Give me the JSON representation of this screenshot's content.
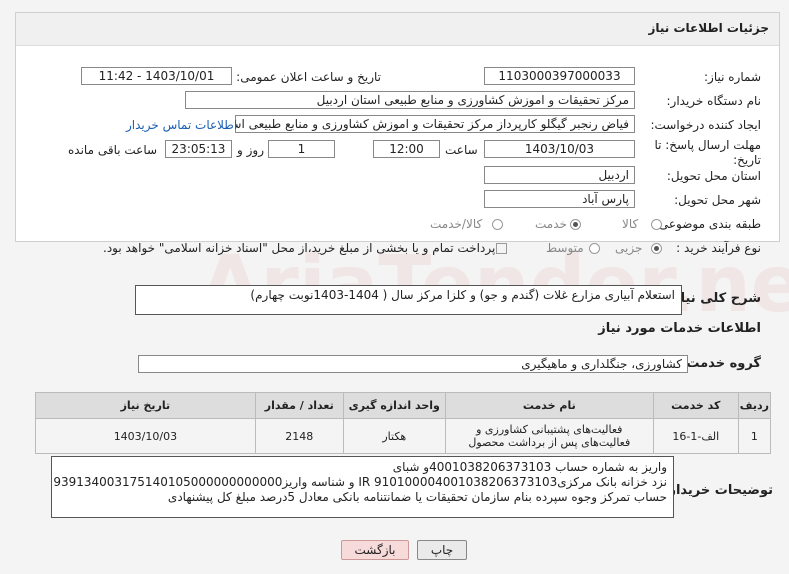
{
  "header": {
    "title": "جزئیات اطلاعات نیاز"
  },
  "form": {
    "need_number_label": "شماره نیاز:",
    "need_number": "1103000397000033",
    "announce_label": "تاریخ و ساعت اعلان عمومی:",
    "announce_value": "1403/10/01 - 11:42",
    "buyer_org_label": "نام دستگاه خریدار:",
    "buyer_org": "مرکز تحقیقات و اموزش کشاورزی و منابع طبیعی استان اردبیل",
    "creator_label": "ایجاد کننده درخواست:",
    "creator": "فیاض رنجبر گیگلو کارپرداز مرکز تحقیقات و اموزش کشاورزی و منابع طبیعی استان اردبیل",
    "contact_link": "اطلاعات تماس خریدار",
    "deadline_label": "مهلت ارسال پاسخ: تا تاریخ:",
    "deadline_date": "1403/10/03",
    "time_label": "ساعت",
    "deadline_time": "12:00",
    "days_value": "1",
    "days_label": "روز و",
    "remaining_time": "23:05:13",
    "remaining_label": "ساعت باقی مانده",
    "province_label": "استان محل تحویل:",
    "province": "اردبیل",
    "city_label": "شهر محل تحویل:",
    "city": "پارس آباد",
    "category_label": "طبقه بندی موضوعی:",
    "category_options": [
      "کالا",
      "خدمت",
      "کالا/خدمت"
    ],
    "process_label": "نوع فرآیند خرید :",
    "process_options": [
      "جزیی",
      "متوسط"
    ],
    "payment_note": "پرداخت تمام و یا بخشی از مبلغ خرید،از محل \"اسناد خزانه اسلامی\" خواهد بود."
  },
  "description": {
    "label": "شرح کلی نیاز:",
    "text": "استعلام آبیاری مزارع غلات (گندم و جو) و کلزا مرکز سال ( 1404-1403نوبت چهارم)"
  },
  "services": {
    "section_title": "اطلاعات خدمات مورد نیاز",
    "group_label": "گروه خدمت:",
    "group_value": "کشاورزی، جنگلداری و ماهیگیری",
    "columns": [
      "ردیف",
      "کد خدمت",
      "نام خدمت",
      "واحد اندازه گیری",
      "تعداد / مقدار",
      "تاریخ نیاز"
    ],
    "rows": [
      {
        "row": "1",
        "code": "الف-1-16",
        "name": "فعالیت‌های پشتیبانی کشاورزی و فعالیت‌های پس از برداشت محصول",
        "unit": "هکتار",
        "qty": "2148",
        "date": "1403/10/03"
      }
    ]
  },
  "buyer_notes": {
    "label": "توضیحات خریدار:",
    "line1": "واریز به شماره حساب 4001038206373103و شبای",
    "line2": "نزد خزانه بانک مرکزیIR 910100004001038206373103 و شناسه واریز939134003175140105000000000000",
    "line3": "حساب تمرکز وجوه سپرده بنام سازمان تحقیقات یا ضمانتنامه بانکی معادل 5درصد مبلغ کل پیشنهادی"
  },
  "buttons": {
    "print": "چاپ",
    "back": "بازگشت"
  },
  "watermark": "AriaTender.net"
}
